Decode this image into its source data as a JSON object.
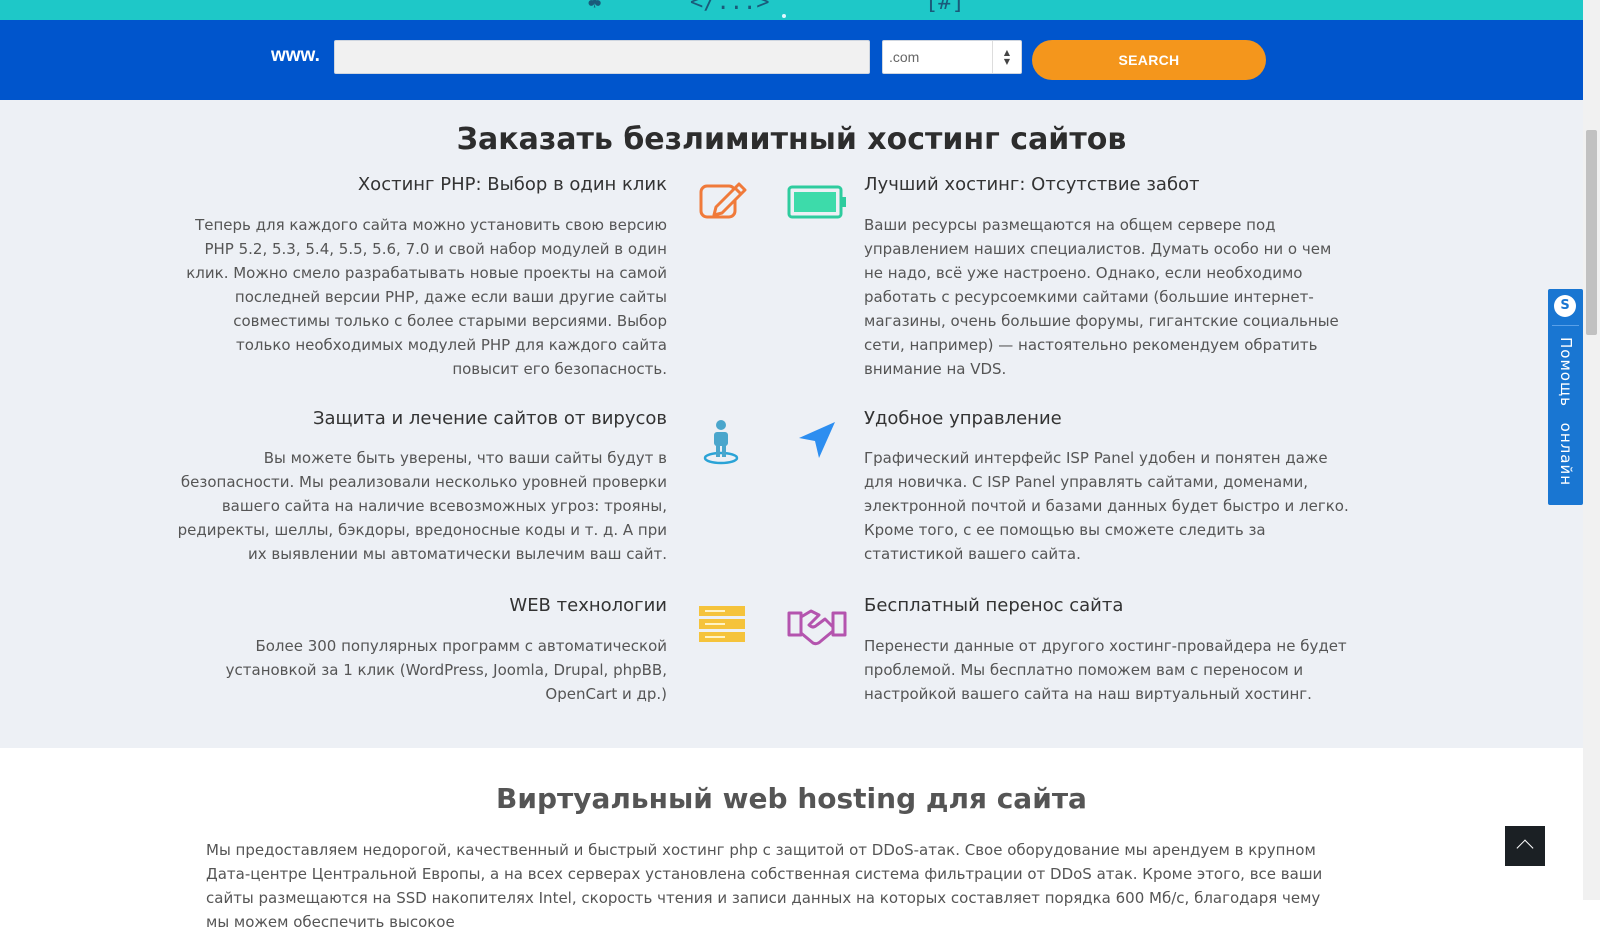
{
  "search": {
    "prefix": "www.",
    "input_value": "",
    "tld_value": ".com",
    "button_label": "SEARCH"
  },
  "features": {
    "title": "Заказать безлимитный хостинг сайтов",
    "items": [
      {
        "title": "Хостинг PHP: Выбор в один клик",
        "text": "Теперь для каждого сайта можно установить свою версию PHP 5.2, 5.3, 5.4, 5.5, 5.6, 7.0 и свой набор модулей в один клик. Можно смело разрабатывать новые проекты на самой последней версии PHP, даже если ваши другие сайты совместимы только с более старыми версиями. Выбор только необходимых модулей PHP для каждого сайта повысит его безопасность.",
        "icon": "edit-icon"
      },
      {
        "title": "Лучший хостинг: Отсутствие забот",
        "text": "Ваши ресурсы размещаются на общем сервере под управлением наших специалистов. Думать особо ни о чем не надо, всё уже настроено. Однако, если необходимо работать с ресурсоемкими сайтами (большие интернет-магазины, очень большие форумы, гигантские социальные сети, например) — настоятельно рекомендуем обратить внимание на VDS.",
        "icon": "battery-icon"
      },
      {
        "title": "Защита и лечение сайтов от вирусов",
        "text": "Вы можете быть уверены, что ваши сайты будут в безопасности. Мы реализовали несколько уровней проверки вашего сайта на наличие всевозможных угроз: трояны, редиректы, шеллы, бэкдоры, вредоносные коды и т. д. А при их выявлении мы автоматически вылечим ваш сайт.",
        "icon": "person-pin-icon"
      },
      {
        "title": "Удобное управление",
        "text": "Графический интерфейс ISP Panel удобен и понятен даже для новичка. С ISP Panel управлять сайтами, доменами, электронной почтой и базами данных будет быстро и легко. Кроме того, с ее помощью вы сможете следить за статистикой вашего сайта.",
        "icon": "navigation-arrow-icon"
      },
      {
        "title": "WEB технологии",
        "text": "Более 300 популярных программ с автоматической установкой за 1 клик (WordPress, Joomla, Drupal, phpBB, OpenCart и др.)",
        "icon": "server-stack-icon"
      },
      {
        "title": "Бесплатный перенос сайта",
        "text": "Перенести данные от другого хостинг-провайдера не будет проблемой. Мы бесплатно поможем вам с переносом и настройкой вашего сайта на наш виртуальный хостинг.",
        "icon": "handshake-icon"
      }
    ]
  },
  "virtual": {
    "title": "Виртуальный web hosting для сайта",
    "text": "Мы предоставляем недорогой, качественный и быстрый хостинг php с защитой от DDoS-атак. Свое оборудование мы арендуем в крупном Дата-центре Центральной Европы, а на всех серверах установлена собственная система фильтрации от DDoS атак. Кроме этого, все ваши сайты размещаются на SSD накопителях Intel, скорость чтения и записи данных на которых составляет порядка 600 Мб/с, благодаря чему мы можем обеспечить высокое"
  },
  "help": {
    "label": "Помощь онлайн",
    "icon": "skype-icon"
  },
  "colors": {
    "teal_strip": "#1ec8c8",
    "search_bar": "#0055cc",
    "search_button": "#f4961c",
    "features_bg": "#edf0f5",
    "help_tab": "#1976d2"
  }
}
